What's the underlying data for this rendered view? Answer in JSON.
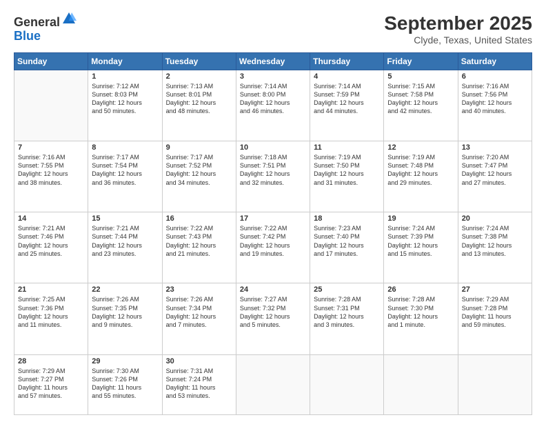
{
  "logo": {
    "general": "General",
    "blue": "Blue"
  },
  "title": "September 2025",
  "location": "Clyde, Texas, United States",
  "days_header": [
    "Sunday",
    "Monday",
    "Tuesday",
    "Wednesday",
    "Thursday",
    "Friday",
    "Saturday"
  ],
  "weeks": [
    [
      {
        "num": "",
        "info": ""
      },
      {
        "num": "1",
        "info": "Sunrise: 7:12 AM\nSunset: 8:03 PM\nDaylight: 12 hours\nand 50 minutes."
      },
      {
        "num": "2",
        "info": "Sunrise: 7:13 AM\nSunset: 8:01 PM\nDaylight: 12 hours\nand 48 minutes."
      },
      {
        "num": "3",
        "info": "Sunrise: 7:14 AM\nSunset: 8:00 PM\nDaylight: 12 hours\nand 46 minutes."
      },
      {
        "num": "4",
        "info": "Sunrise: 7:14 AM\nSunset: 7:59 PM\nDaylight: 12 hours\nand 44 minutes."
      },
      {
        "num": "5",
        "info": "Sunrise: 7:15 AM\nSunset: 7:58 PM\nDaylight: 12 hours\nand 42 minutes."
      },
      {
        "num": "6",
        "info": "Sunrise: 7:16 AM\nSunset: 7:56 PM\nDaylight: 12 hours\nand 40 minutes."
      }
    ],
    [
      {
        "num": "7",
        "info": "Sunrise: 7:16 AM\nSunset: 7:55 PM\nDaylight: 12 hours\nand 38 minutes."
      },
      {
        "num": "8",
        "info": "Sunrise: 7:17 AM\nSunset: 7:54 PM\nDaylight: 12 hours\nand 36 minutes."
      },
      {
        "num": "9",
        "info": "Sunrise: 7:17 AM\nSunset: 7:52 PM\nDaylight: 12 hours\nand 34 minutes."
      },
      {
        "num": "10",
        "info": "Sunrise: 7:18 AM\nSunset: 7:51 PM\nDaylight: 12 hours\nand 32 minutes."
      },
      {
        "num": "11",
        "info": "Sunrise: 7:19 AM\nSunset: 7:50 PM\nDaylight: 12 hours\nand 31 minutes."
      },
      {
        "num": "12",
        "info": "Sunrise: 7:19 AM\nSunset: 7:48 PM\nDaylight: 12 hours\nand 29 minutes."
      },
      {
        "num": "13",
        "info": "Sunrise: 7:20 AM\nSunset: 7:47 PM\nDaylight: 12 hours\nand 27 minutes."
      }
    ],
    [
      {
        "num": "14",
        "info": "Sunrise: 7:21 AM\nSunset: 7:46 PM\nDaylight: 12 hours\nand 25 minutes."
      },
      {
        "num": "15",
        "info": "Sunrise: 7:21 AM\nSunset: 7:44 PM\nDaylight: 12 hours\nand 23 minutes."
      },
      {
        "num": "16",
        "info": "Sunrise: 7:22 AM\nSunset: 7:43 PM\nDaylight: 12 hours\nand 21 minutes."
      },
      {
        "num": "17",
        "info": "Sunrise: 7:22 AM\nSunset: 7:42 PM\nDaylight: 12 hours\nand 19 minutes."
      },
      {
        "num": "18",
        "info": "Sunrise: 7:23 AM\nSunset: 7:40 PM\nDaylight: 12 hours\nand 17 minutes."
      },
      {
        "num": "19",
        "info": "Sunrise: 7:24 AM\nSunset: 7:39 PM\nDaylight: 12 hours\nand 15 minutes."
      },
      {
        "num": "20",
        "info": "Sunrise: 7:24 AM\nSunset: 7:38 PM\nDaylight: 12 hours\nand 13 minutes."
      }
    ],
    [
      {
        "num": "21",
        "info": "Sunrise: 7:25 AM\nSunset: 7:36 PM\nDaylight: 12 hours\nand 11 minutes."
      },
      {
        "num": "22",
        "info": "Sunrise: 7:26 AM\nSunset: 7:35 PM\nDaylight: 12 hours\nand 9 minutes."
      },
      {
        "num": "23",
        "info": "Sunrise: 7:26 AM\nSunset: 7:34 PM\nDaylight: 12 hours\nand 7 minutes."
      },
      {
        "num": "24",
        "info": "Sunrise: 7:27 AM\nSunset: 7:32 PM\nDaylight: 12 hours\nand 5 minutes."
      },
      {
        "num": "25",
        "info": "Sunrise: 7:28 AM\nSunset: 7:31 PM\nDaylight: 12 hours\nand 3 minutes."
      },
      {
        "num": "26",
        "info": "Sunrise: 7:28 AM\nSunset: 7:30 PM\nDaylight: 12 hours\nand 1 minute."
      },
      {
        "num": "27",
        "info": "Sunrise: 7:29 AM\nSunset: 7:28 PM\nDaylight: 11 hours\nand 59 minutes."
      }
    ],
    [
      {
        "num": "28",
        "info": "Sunrise: 7:29 AM\nSunset: 7:27 PM\nDaylight: 11 hours\nand 57 minutes."
      },
      {
        "num": "29",
        "info": "Sunrise: 7:30 AM\nSunset: 7:26 PM\nDaylight: 11 hours\nand 55 minutes."
      },
      {
        "num": "30",
        "info": "Sunrise: 7:31 AM\nSunset: 7:24 PM\nDaylight: 11 hours\nand 53 minutes."
      },
      {
        "num": "",
        "info": ""
      },
      {
        "num": "",
        "info": ""
      },
      {
        "num": "",
        "info": ""
      },
      {
        "num": "",
        "info": ""
      }
    ]
  ]
}
